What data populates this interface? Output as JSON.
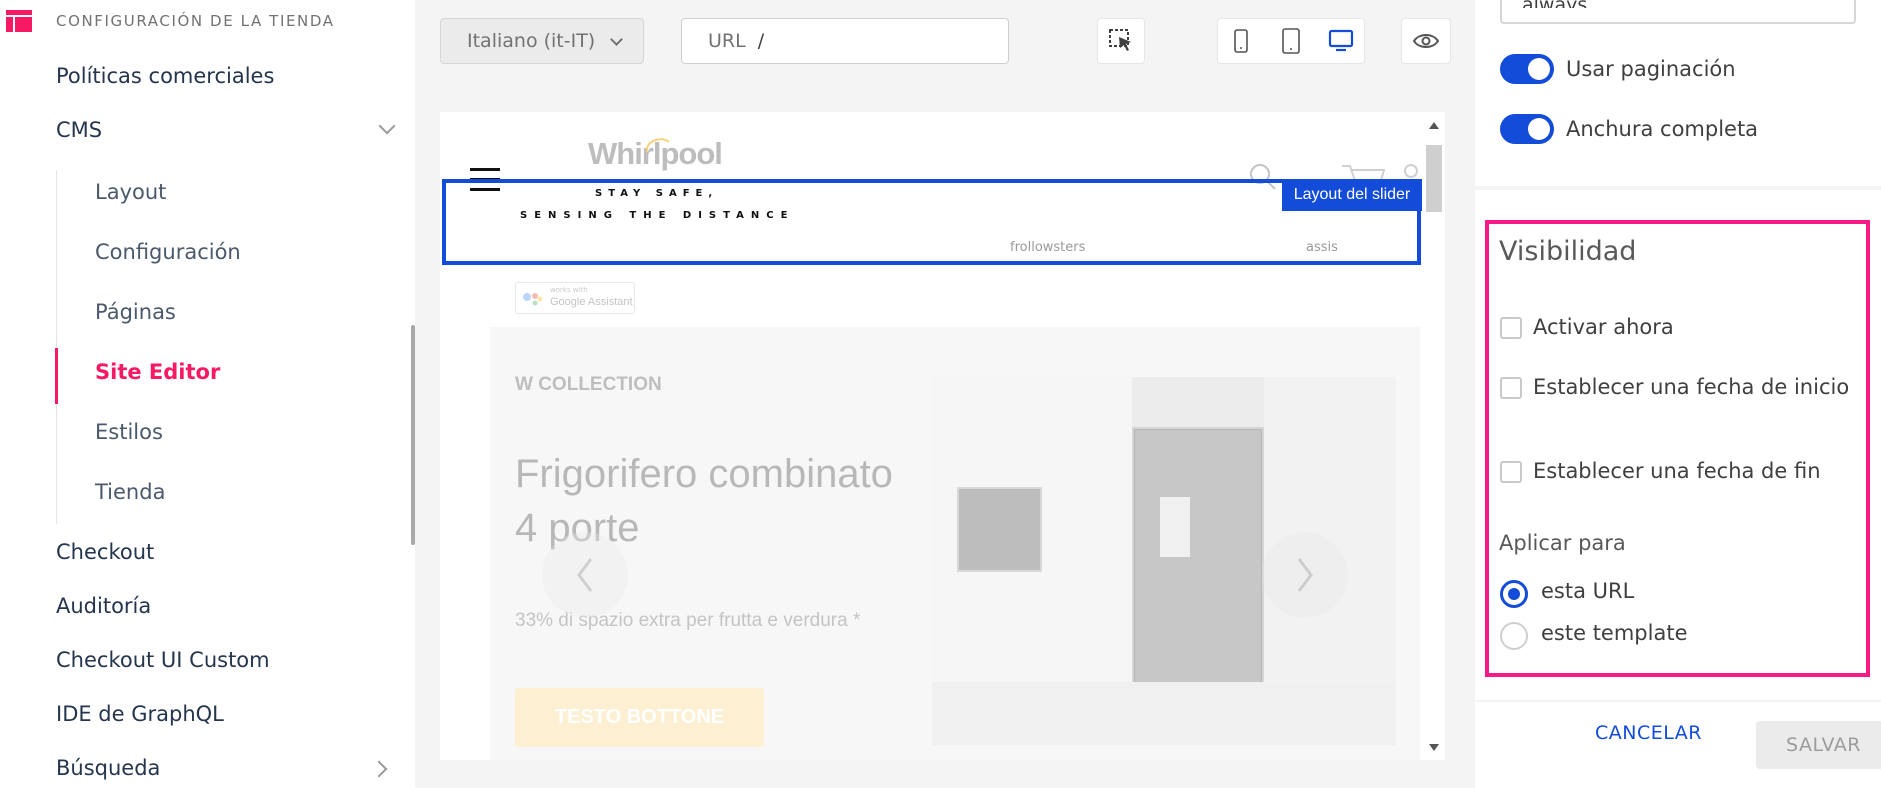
{
  "sidebar": {
    "section_title": "CONFIGURACIÓN DE LA TIENDA",
    "items_top": [
      "Políticas comerciales",
      "CMS"
    ],
    "cms_children": [
      "Layout",
      "Configuración",
      "Páginas",
      "Site Editor",
      "Estilos",
      "Tienda"
    ],
    "active_child": "Site Editor",
    "items_bottom": [
      "Checkout",
      "Auditoría",
      "Checkout UI Custom",
      "IDE de GraphQL",
      "Búsqueda"
    ]
  },
  "toolbar": {
    "locale": "Italiano (it-IT)",
    "url_label": "URL",
    "url_value": "/"
  },
  "preview": {
    "brand": "Whirlpool",
    "banner_line1": "STAY SAFE,",
    "banner_line2": "SENSING THE DISTANCE",
    "selection_label": "Layout del slider",
    "google_badge_small": "works with",
    "google_badge": "Google Assistant",
    "collection": "W COLLECTION",
    "headline_1": "Frigorifero combinato",
    "headline_2": "4 porte",
    "subtitle": "33% di spazio extra per frutta e verdura *",
    "cta": "TESTO BOTTONE",
    "nav_fragment_1": "frollowsters",
    "nav_fragment_2": "assis"
  },
  "panel": {
    "top_input_fragment": "always",
    "toggles": [
      {
        "label": "Usar paginación",
        "on": true
      },
      {
        "label": "Anchura completa",
        "on": true
      }
    ],
    "visibility": {
      "title": "Visibilidad",
      "checkboxes": [
        "Activar ahora",
        "Establecer una fecha de inicio",
        "Establecer una fecha de fin"
      ],
      "apply_label": "Aplicar para",
      "radios": [
        {
          "label": "esta URL",
          "selected": true
        },
        {
          "label": "este template",
          "selected": false
        }
      ]
    },
    "cancel": "CANCELAR",
    "save": "SALVAR"
  },
  "colors": {
    "accent_pink": "#f71963",
    "highlight_magenta": "#f71985",
    "primary_blue": "#134cd8",
    "cta_yellow": "#fde8b4"
  }
}
